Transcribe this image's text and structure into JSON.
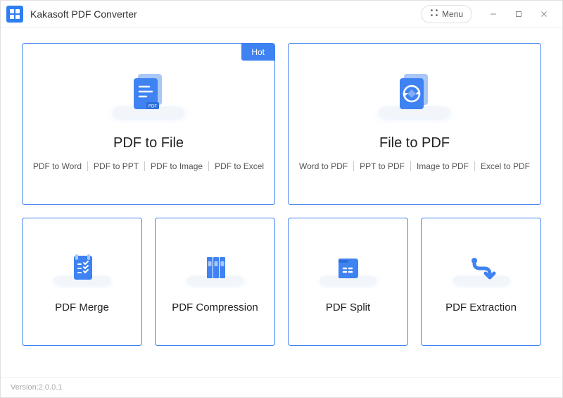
{
  "app": {
    "title": "Kakasoft PDF Converter",
    "menu_label": "Menu",
    "version_label": "Version:2.0.0.1"
  },
  "cards": {
    "pdf_to_file": {
      "title": "PDF to File",
      "badge": "Hot",
      "options": [
        "PDF to Word",
        "PDF to PPT",
        "PDF to Image",
        "PDF to Excel"
      ]
    },
    "file_to_pdf": {
      "title": "File to PDF",
      "options": [
        "Word to PDF",
        "PPT to PDF",
        "Image to PDF",
        "Excel to PDF"
      ]
    },
    "merge": {
      "title": "PDF Merge"
    },
    "compression": {
      "title": "PDF Compression"
    },
    "split": {
      "title": "PDF Split"
    },
    "extraction": {
      "title": "PDF Extraction"
    }
  }
}
